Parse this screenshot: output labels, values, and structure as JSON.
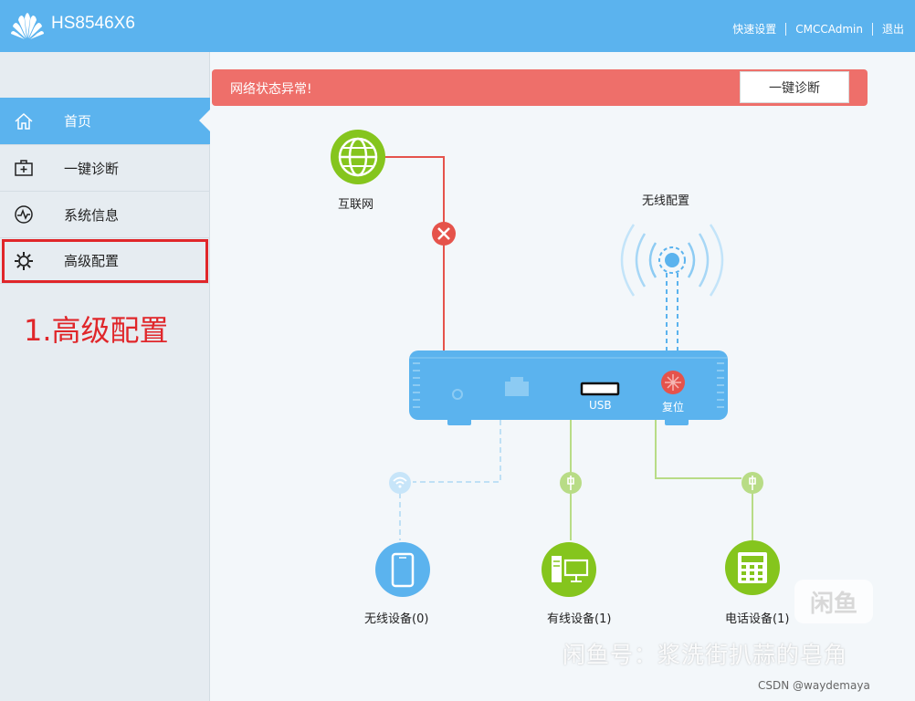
{
  "header": {
    "title": "HS8546X6",
    "links": [
      "快速设置",
      "CMCCAdmin",
      "退出"
    ]
  },
  "sidebar": {
    "items": [
      {
        "label": "首页",
        "icon": "home-icon",
        "active": true
      },
      {
        "label": "一键诊断",
        "icon": "first-aid-icon",
        "active": false
      },
      {
        "label": "系统信息",
        "icon": "pulse-icon",
        "active": false
      },
      {
        "label": "高级配置",
        "icon": "gear-icon",
        "active": false
      }
    ]
  },
  "annotation": "1.高级配置",
  "alert": {
    "message": "网络状态异常!",
    "button": "一键诊断"
  },
  "topology": {
    "internet": "互联网",
    "wireless_config": "无线配置",
    "usb": "USB",
    "reset": "复位",
    "wireless_devices": "无线设备(0)",
    "wired_devices": "有线设备(1)",
    "phone_devices": "电话设备(1)"
  },
  "watermark": "闲鱼号：浆洗街扒蒜的皂角",
  "badge": "闲鱼",
  "credit": "CSDN @waydemaya",
  "colors": {
    "header": "#5bb3ee",
    "alert": "#ee6f6a",
    "green": "#85c51d",
    "error": "#e5534b"
  }
}
